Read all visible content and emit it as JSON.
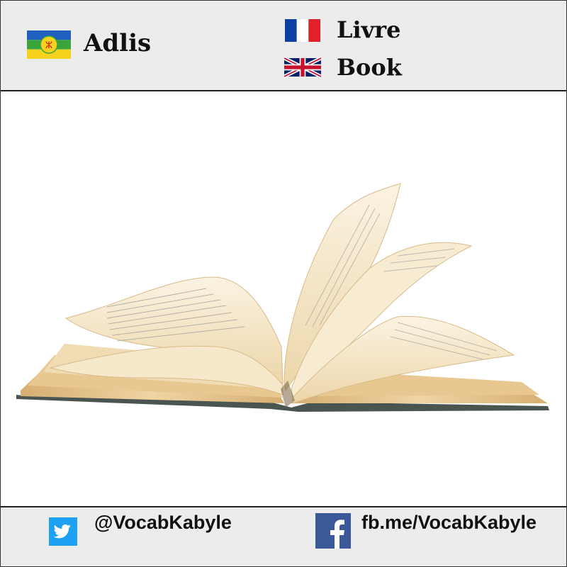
{
  "header": {
    "kabyle_word": "Adlis",
    "french_word": "Livre",
    "english_word": "Book",
    "flags": {
      "kabyle": "kabyle-flag-icon",
      "french": "french-flag-icon",
      "english": "uk-flag-icon"
    }
  },
  "image": {
    "subject": "open-book-illustration"
  },
  "footer": {
    "twitter_handle": "@VocabKabyle",
    "facebook_link": "fb.me/VocabKabyle",
    "twitter_icon": "twitter-icon",
    "facebook_icon": "facebook-icon"
  },
  "colors": {
    "header_bg": "#ececec",
    "border": "#222222",
    "twitter_blue": "#1da1f2",
    "facebook_blue": "#3b5998",
    "page_cream": "#f3e6c9",
    "page_edge": "#e0b97d",
    "cover_dark": "#4a5450"
  }
}
